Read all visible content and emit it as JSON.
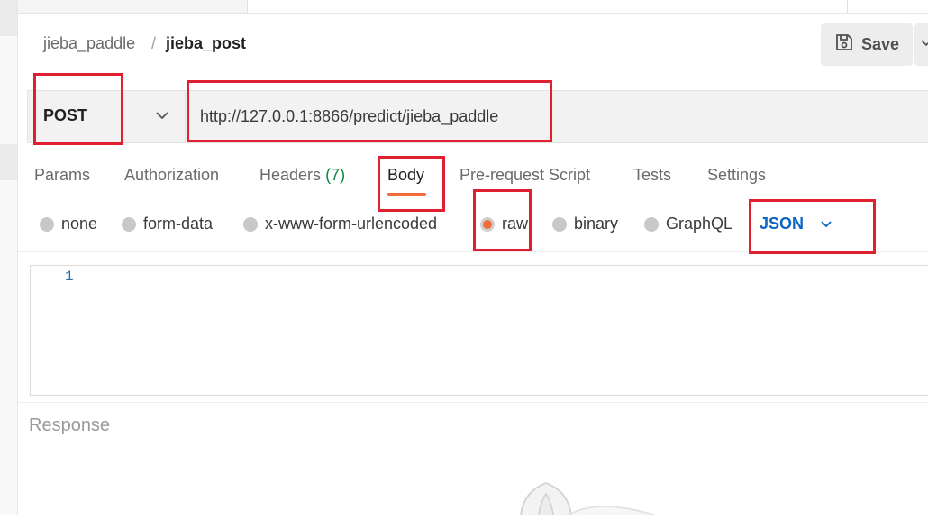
{
  "breadcrumb": {
    "parent": "jieba_paddle",
    "separator": "/",
    "current": "jieba_post"
  },
  "toolbar": {
    "save_label": "Save",
    "save_icon": "save-disk-icon"
  },
  "request": {
    "method": "POST",
    "url": "http://127.0.0.1:8866/predict/jieba_paddle"
  },
  "tabs": [
    {
      "label": "Params"
    },
    {
      "label": "Authorization"
    },
    {
      "label": "Headers",
      "count": "(7)"
    },
    {
      "label": "Body",
      "active": true
    },
    {
      "label": "Pre-request Script"
    },
    {
      "label": "Tests"
    },
    {
      "label": "Settings"
    }
  ],
  "body_types": [
    {
      "label": "none",
      "selected": false
    },
    {
      "label": "form-data",
      "selected": false
    },
    {
      "label": "x-www-form-urlencoded",
      "selected": false
    },
    {
      "label": "raw",
      "selected": true
    },
    {
      "label": "binary",
      "selected": false
    },
    {
      "label": "GraphQL",
      "selected": false
    }
  ],
  "raw_format": "JSON",
  "editor": {
    "line_numbers": [
      "1"
    ]
  },
  "response": {
    "title": "Response"
  },
  "colors": {
    "accent": "#f26b3a",
    "link_blue": "#0b66c3",
    "count_green": "#0b8a3d",
    "annotation_red": "#e02030"
  }
}
